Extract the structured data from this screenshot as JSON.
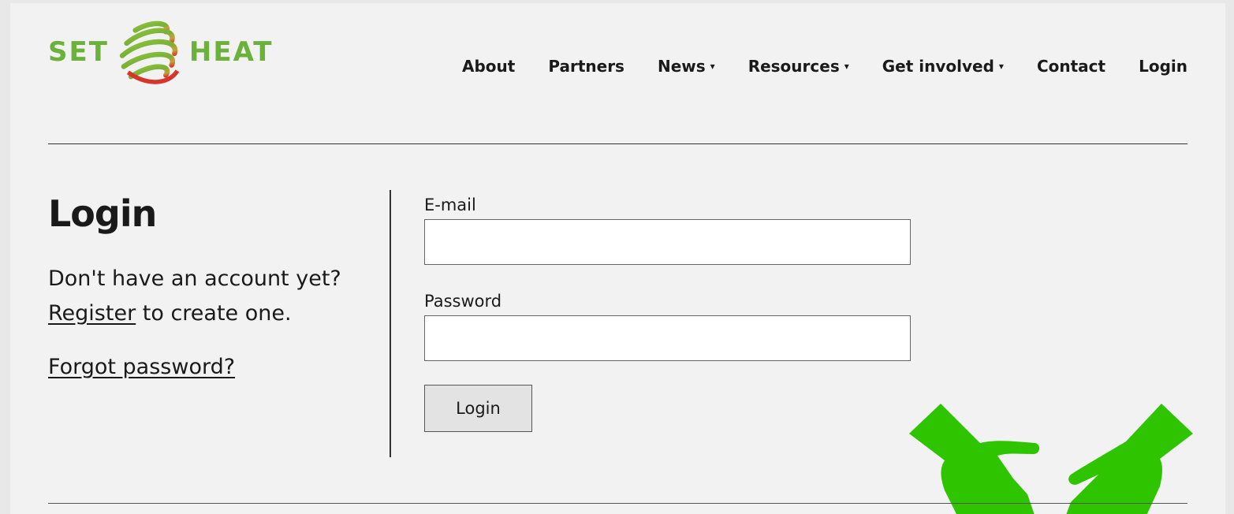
{
  "brand": {
    "left": "SET",
    "right": "HEAT",
    "color": "#6ab23a"
  },
  "nav": {
    "items": [
      {
        "label": "About",
        "dropdown": false
      },
      {
        "label": "Partners",
        "dropdown": false
      },
      {
        "label": "News",
        "dropdown": true
      },
      {
        "label": "Resources",
        "dropdown": true
      },
      {
        "label": "Get involved",
        "dropdown": true
      },
      {
        "label": "Contact",
        "dropdown": false
      },
      {
        "label": "Login",
        "dropdown": false
      }
    ],
    "chevron": "⌄"
  },
  "login": {
    "title": "Login",
    "intro_before": "Don't have an account yet? ",
    "register_link": "Register",
    "intro_after": " to create one.",
    "forgot": "Forgot password?"
  },
  "form": {
    "email_label": "E-mail",
    "email_value": "",
    "password_label": "Password",
    "password_value": "",
    "submit": "Login"
  },
  "colors": {
    "hands": "#2ec400",
    "background": "#f2f2f2"
  }
}
